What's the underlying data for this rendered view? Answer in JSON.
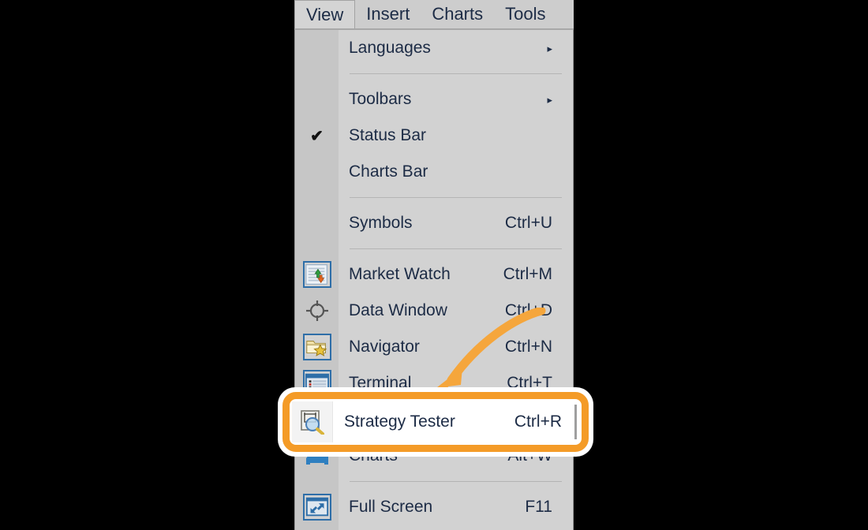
{
  "menubar": {
    "items": [
      {
        "label": "View",
        "active": true
      },
      {
        "label": "Insert",
        "active": false
      },
      {
        "label": "Charts",
        "active": false
      },
      {
        "label": "Tools",
        "active": false
      }
    ]
  },
  "menu": {
    "items": [
      {
        "label": "Languages",
        "accel": "",
        "submenu": "▸",
        "icon": "",
        "checked": false
      },
      {
        "separator": true
      },
      {
        "label": "Toolbars",
        "accel": "",
        "submenu": "▸",
        "icon": "",
        "checked": false
      },
      {
        "label": "Status Bar",
        "accel": "",
        "submenu": "",
        "icon": "",
        "checked": true
      },
      {
        "label": "Charts Bar",
        "accel": "",
        "submenu": "",
        "icon": "",
        "checked": false
      },
      {
        "separator": true
      },
      {
        "label": "Symbols",
        "accel": "Ctrl+U",
        "submenu": "",
        "icon": "",
        "checked": false
      },
      {
        "separator": true
      },
      {
        "label": "Market Watch",
        "accel": "Ctrl+M",
        "submenu": "",
        "icon": "market-watch-icon",
        "checked": false
      },
      {
        "label": "Data Window",
        "accel": "Ctrl+D",
        "submenu": "",
        "icon": "data-window-icon",
        "checked": false
      },
      {
        "label": "Navigator",
        "accel": "Ctrl+N",
        "submenu": "",
        "icon": "navigator-icon",
        "checked": false
      },
      {
        "label": "Terminal",
        "accel": "Ctrl+T",
        "submenu": "",
        "icon": "terminal-icon",
        "checked": false
      },
      {
        "label": "Strategy Tester",
        "accel": "Ctrl+R",
        "submenu": "",
        "icon": "strategy-tester-icon",
        "checked": false
      },
      {
        "label": "Charts",
        "accel": "Alt+W",
        "submenu": "",
        "icon": "charts-icon",
        "checked": false
      },
      {
        "separator": true
      },
      {
        "label": "Full Screen",
        "accel": "F11",
        "submenu": "",
        "icon": "full-screen-icon",
        "checked": false
      }
    ]
  },
  "highlight": {
    "label": "Strategy Tester",
    "accel": "Ctrl+R",
    "icon": "strategy-tester-icon",
    "border_color": "#f49b27",
    "background": "#ffffff"
  },
  "annotation": {
    "arrow_color": "#f5a63c",
    "points_to": "Strategy Tester"
  },
  "colors": {
    "menu_background": "#d2d2d2",
    "gutter": "#c6c6c6",
    "menubar_background": "#cdcdcd",
    "text": "#1c2b45",
    "separator": "#b4b4b4",
    "icon_border_blue": "#2e6ea8",
    "accent_orange": "#f49b27",
    "page_background": "#000000"
  }
}
